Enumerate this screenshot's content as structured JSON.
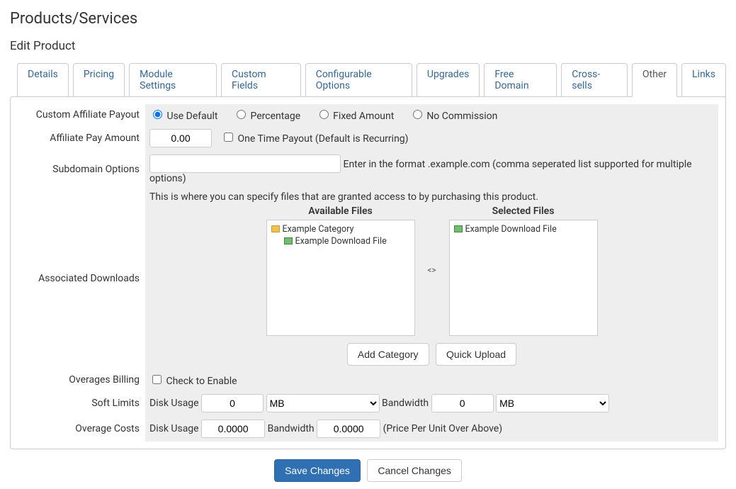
{
  "page": {
    "title": "Products/Services",
    "subtitle": "Edit Product"
  },
  "tabs": {
    "items": [
      "Details",
      "Pricing",
      "Module Settings",
      "Custom Fields",
      "Configurable Options",
      "Upgrades",
      "Free Domain",
      "Cross-sells",
      "Other",
      "Links"
    ],
    "active": "Other"
  },
  "form": {
    "affiliate_payout": {
      "label": "Custom Affiliate Payout",
      "options": {
        "default": "Use Default",
        "percentage": "Percentage",
        "fixed": "Fixed Amount",
        "none": "No Commission"
      },
      "selected": "default"
    },
    "affiliate_amount": {
      "label": "Affiliate Pay Amount",
      "value": "0.00",
      "onetime_label": "One Time Payout (Default is Recurring)",
      "onetime_checked": false
    },
    "subdomain": {
      "label": "Subdomain Options",
      "value": "",
      "hint": "Enter in the format .example.com (comma seperated list supported for multiple options)"
    },
    "downloads": {
      "label": "Associated Downloads",
      "intro": "This is where you can specify files that are granted access to by purchasing this product.",
      "available_heading": "Available Files",
      "selected_heading": "Selected Files",
      "available": {
        "category": "Example Category",
        "file": "Example Download File"
      },
      "selected_file": "Example Download File",
      "add_category_btn": "Add Category",
      "quick_upload_btn": "Quick Upload"
    },
    "overages_billing": {
      "label": "Overages Billing",
      "checkbox_label": "Check to Enable",
      "checked": false
    },
    "soft_limits": {
      "label": "Soft Limits",
      "disk_label": "Disk Usage",
      "disk_value": "0",
      "disk_unit": "MB",
      "bw_label": "Bandwidth",
      "bw_value": "0",
      "bw_unit": "MB"
    },
    "overage_costs": {
      "label": "Overage Costs",
      "disk_label": "Disk Usage",
      "disk_value": "0.0000",
      "bw_label": "Bandwidth",
      "bw_value": "0.0000",
      "hint": "(Price Per Unit Over Above)"
    }
  },
  "buttons": {
    "save": "Save Changes",
    "cancel": "Cancel Changes"
  }
}
